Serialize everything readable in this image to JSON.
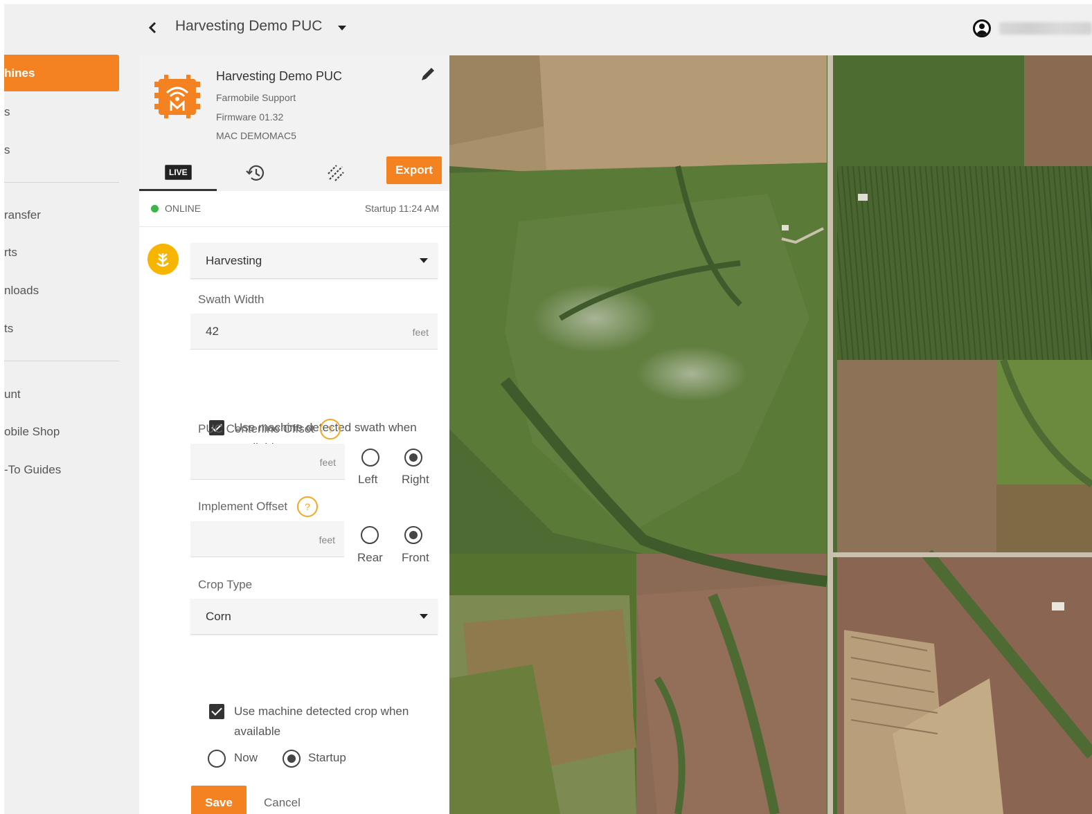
{
  "sidebar": {
    "items": [
      {
        "label": "hines"
      },
      {
        "label": "s"
      },
      {
        "label": "s"
      },
      {
        "label": "ransfer"
      },
      {
        "label": "rts"
      },
      {
        "label": "nloads"
      },
      {
        "label": "ts"
      },
      {
        "label": "unt"
      },
      {
        "label": "obile Shop"
      },
      {
        "label": "-To Guides"
      }
    ]
  },
  "topbar": {
    "back_icon": "chevron-left-icon",
    "title": "Harvesting Demo PUC"
  },
  "device": {
    "name": "Harvesting Demo PUC",
    "org": "Farmobile Support",
    "firmware": "Firmware 01.32",
    "mac": "MAC DEMOMAC5"
  },
  "tabs": {
    "live": "LIVE",
    "export": "Export"
  },
  "status": {
    "state": "ONLINE",
    "startup": "Startup 11:24 AM",
    "online_color": "#3cb54a"
  },
  "form": {
    "operation": "Harvesting",
    "swath_label": "Swath Width",
    "swath_value": "42",
    "swath_unit": "feet",
    "swath_checkbox": "Use machine detected swath when available",
    "centerline_label": "PUC Centerline Offset",
    "centerline_unit": "feet",
    "centerline_left": "Left",
    "centerline_right": "Right",
    "implement_label": "Implement Offset",
    "implement_unit": "feet",
    "implement_rear": "Rear",
    "implement_front": "Front",
    "crop_label": "Crop Type",
    "crop_value": "Corn",
    "crop_checkbox": "Use machine detected crop when available",
    "apply_now": "Now",
    "apply_startup": "Startup",
    "help_glyph": "?",
    "save": "Save",
    "cancel": "Cancel"
  },
  "colors": {
    "accent": "#f58220",
    "mode_icon": "#f7b500"
  }
}
